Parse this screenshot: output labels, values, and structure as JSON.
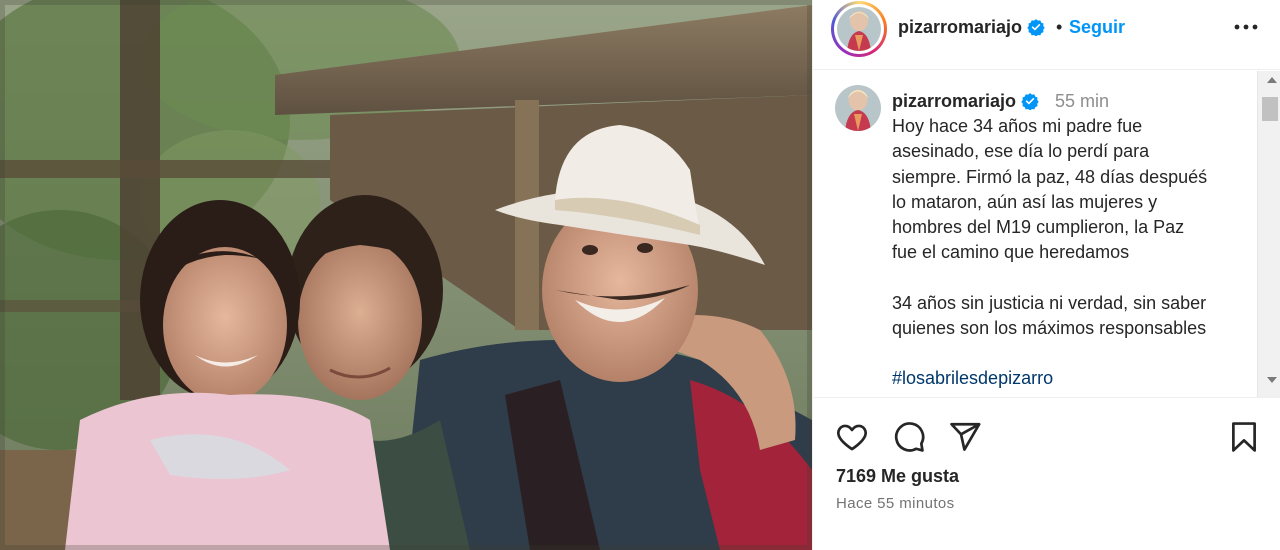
{
  "post": {
    "photo": {
      "icon": "photo-image"
    },
    "header": {
      "username": "pizarromariajo",
      "separator": "•",
      "follow_label": "Seguir",
      "more_icon": "more-horizontal-icon",
      "verified_icon": "verified-badge-icon"
    },
    "caption": {
      "username": "pizarromariajo",
      "time": "55 min",
      "lines": [
        "Hoy hace 34 años mi padre fue",
        "asesinado, ese día lo perdí para",
        "siempre. Firmó la paz, 48 días despuéś",
        "lo mataron, aún así las mujeres y",
        "hombres del M19 cumplieron, la Paz",
        "fue el camino que heredamos"
      ],
      "lines2": [
        "34 años sin justicia ni verdad, sin saber",
        "quienes son los máximos responsables"
      ],
      "hashtag": "#losabrilesdepizarro"
    },
    "actions": {
      "like_icon": "heart-icon",
      "comment_icon": "comment-icon",
      "share_icon": "share-icon",
      "save_icon": "bookmark-icon"
    },
    "likes_text": "7169 Me gusta",
    "time_ago": "Hace 55 minutos"
  },
  "colors": {
    "accent": "#0095f6",
    "verified": "#0095f6",
    "hashtag": "#00376b",
    "muted": "#8e8e8e"
  }
}
